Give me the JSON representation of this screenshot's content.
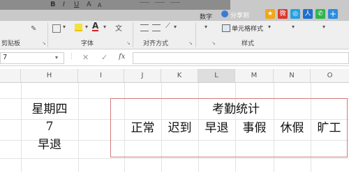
{
  "ribbon": {
    "top_glyphs": [
      "B",
      "I",
      "U",
      "A",
      "A"
    ],
    "number_label": "数字",
    "share_label": "分享到",
    "font_group_label": "字体",
    "clipboard_group_label": "剪贴板",
    "align_group_label": "对齐方式",
    "styles_group_label": "样式",
    "cell_styles_label": "单元格样式",
    "dropdown_arrow": "▾",
    "launcher_glyph": "↘"
  },
  "formula_bar": {
    "namebox_value": "7",
    "cancel_glyph": "✕",
    "confirm_glyph": "✓",
    "fx_label": "fx",
    "formula_value": ""
  },
  "columns": [
    "H",
    "I",
    "J",
    "K",
    "L",
    "M",
    "N",
    "O"
  ],
  "cells": {
    "h_row1": "星期四",
    "h_row2": "7",
    "h_row3": "早退",
    "merged_title": "考勤统计",
    "categories": [
      "正常",
      "迟到",
      "早退",
      "事假",
      "休假",
      "旷工"
    ]
  },
  "colors": {
    "accent_red_border": "#d27a7a",
    "ribbon_bg": "#efefef",
    "column_header_bg": "#f4f4f4"
  }
}
